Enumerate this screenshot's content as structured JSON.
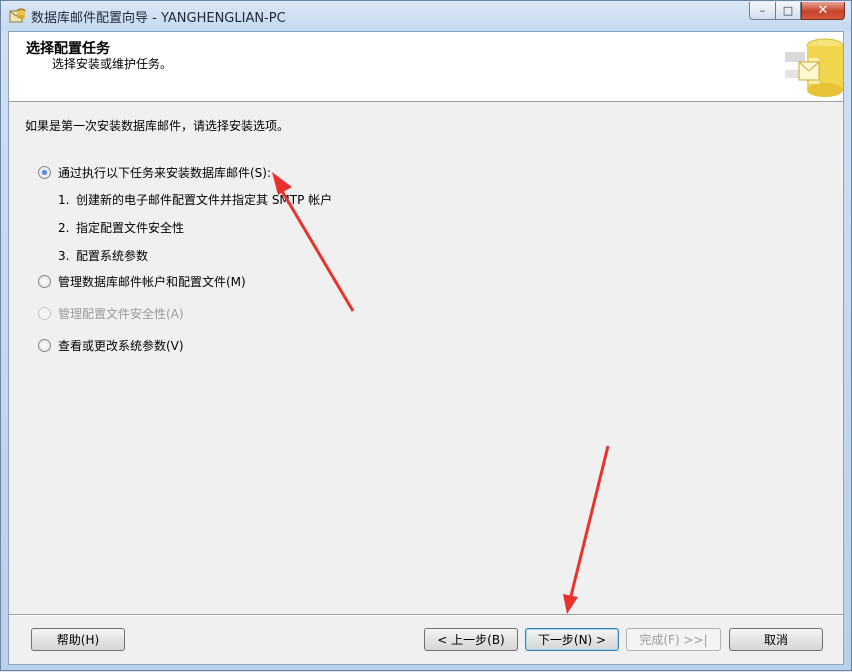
{
  "window": {
    "title": "数据库邮件配置向导 - YANGHENGLIAN-PC",
    "controls": {
      "minimize": "–",
      "maximize": "□",
      "close": "✕"
    }
  },
  "header": {
    "title": "选择配置任务",
    "subtitle": "选择安装或维护任务。"
  },
  "intro": "如果是第一次安装数据库邮件，请选择安装选项。",
  "options": [
    {
      "label": "通过执行以下任务来安装数据库邮件(S):",
      "checked": true,
      "enabled": true
    },
    {
      "label": "管理数据库邮件帐户和配置文件(M)",
      "checked": false,
      "enabled": true
    },
    {
      "label": "管理配置文件安全性(A)",
      "checked": false,
      "enabled": false
    },
    {
      "label": "查看或更改系统参数(V)",
      "checked": false,
      "enabled": true
    }
  ],
  "steps": [
    {
      "num": "1.",
      "text": "创建新的电子邮件配置文件并指定其 SMTP 帐户"
    },
    {
      "num": "2.",
      "text": "指定配置文件安全性"
    },
    {
      "num": "3.",
      "text": "配置系统参数"
    }
  ],
  "buttons": {
    "help": "帮助(H)",
    "back": "< 上一步(B)",
    "next": "下一步(N) >",
    "finish": "完成(F) >>|",
    "cancel": "取消"
  },
  "colors": {
    "annotation_arrow": "#e8332c",
    "default_button_border": "#3c7fb1"
  }
}
